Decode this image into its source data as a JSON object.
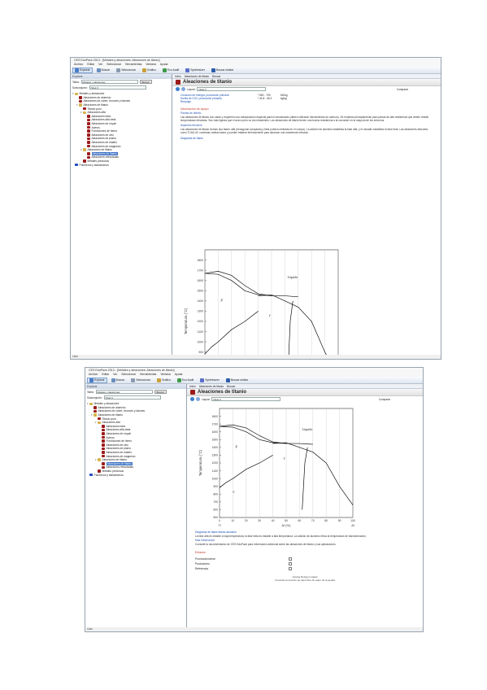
{
  "app": {
    "title": "CES EduPack 2013 - [Metales y aleaciones: Aleaciones de titanio]",
    "menu": [
      "Archivo",
      "Editar",
      "Ver",
      "Seleccionar",
      "Herramientas",
      "Ventana",
      "Ayuda"
    ],
    "toolbar": {
      "browse": "Explorar",
      "search": "Buscar",
      "select": "Seleccionar",
      "chart": "Gráfico",
      "eco": "Eco Audit",
      "synthesizer": "Synthesizer",
      "find": "Buscar similar",
      "home": "Inicio"
    },
    "status": "Listo",
    "colors": {
      "accent": "#3a6fc4",
      "record_icon": "#9b1b1b",
      "section_title": "#c0392b"
    }
  },
  "left": {
    "header": "Explorar",
    "table_label": "Tabla:",
    "table_value": "Metales y aleaciones",
    "subset_label": "Subconjunto:",
    "subset_value": "Nivel 3",
    "search_button": "Buscar",
    "tree": [
      {
        "label": "Metales y aleaciones",
        "depth": 0,
        "type": "folder"
      },
      {
        "label": "Aleaciones de aluminio",
        "depth": 1,
        "type": "record"
      },
      {
        "label": "Aleaciones de cobre, bronces y latones",
        "depth": 1,
        "type": "record"
      },
      {
        "label": "Aleaciones de titanio",
        "depth": 1,
        "type": "folder"
      },
      {
        "label": "Titanio puro",
        "depth": 2,
        "type": "record"
      },
      {
        "label": "Aleaciones alfa",
        "depth": 2,
        "type": "folder"
      },
      {
        "label": "Aleaciones beta",
        "depth": 3,
        "type": "record"
      },
      {
        "label": "Aleaciones alfa-beta",
        "depth": 3,
        "type": "record"
      },
      {
        "label": "Aleaciones de níquel",
        "depth": 3,
        "type": "record"
      },
      {
        "label": "Aceros",
        "depth": 3,
        "type": "record"
      },
      {
        "label": "Fundiciones de hierro",
        "depth": 3,
        "type": "record"
      },
      {
        "label": "Aleaciones de zinc",
        "depth": 3,
        "type": "record"
      },
      {
        "label": "Aleaciones de plomo",
        "depth": 3,
        "type": "record"
      },
      {
        "label": "Aleaciones de estaño",
        "depth": 3,
        "type": "record"
      },
      {
        "label": "Aleaciones de magnesio",
        "depth": 3,
        "type": "record"
      },
      {
        "label": "Aleaciones de titanio",
        "depth": 2,
        "type": "folder"
      },
      {
        "label": "Aleaciones de titanio",
        "depth": 3,
        "type": "selected"
      },
      {
        "label": "Aleaciones refractarias",
        "depth": 3,
        "type": "record"
      },
      {
        "label": "Metales preciosos",
        "depth": 2,
        "type": "record"
      },
      {
        "label": "Polímeros y elastómeros",
        "depth": 0,
        "type": "blue"
      }
    ]
  },
  "right": {
    "tabs": [
      "Inicio",
      "Aleaciones de titanio",
      "Buscar"
    ],
    "record_title": "Aleaciones de titanio",
    "layout_label": "Layout:",
    "layout_value": "Nivel 3",
    "compare_label": "Comparar",
    "properties": [
      {
        "name": "Consumo de energía, producción primaria",
        "value": "* 600 - 700",
        "unit": "MJ/kg"
      },
      {
        "name": "Huella de CO2, producción primaria",
        "value": "* 41.8 - 46.2",
        "unit": "kg/kg"
      },
      {
        "name": "Reciclaje",
        "value": "",
        "unit": ""
      }
    ],
    "support_title": "Información de apoyo",
    "design_title": "Pautas de diseño",
    "design_text": "Las aleaciones de titanio son caras y requieren una manipulación especial para el mecanizado (deben utilizarse herramientas de carburo). Se emplean principalmente para piezas de alta resistencia que deben resistir temperaturas elevadas. Son más ligeras que el acero pero no tan resistentes. Las aleaciones de titanio tienen una buena resistencia a la corrosión en la mayoría de los entornos.",
    "tech_title": "Aspectos técnicos",
    "tech_text": "Las aleaciones de titanio forman dos fases: alfa (hexagonal compacta) y beta (cúbica centrada en el cuerpo). La adición de aluminio estabiliza la fase alfa, y el vanadio estabiliza la fase beta. Las aleaciones alfa-beta, como Ti-6Al-4V, combinan ambas fases y pueden tratarse térmicamente para alcanzar una resistencia elevada.",
    "diagram_link": "Diagrama de fases",
    "diagram_caption": "Diagrama de fases titanio-aluminio",
    "diagram_desc": "La fase alfa es estable a baja temperatura; la fase beta es estable a alta temperatura. La adición de aluminio eleva la temperatura de transformación.",
    "further_title": "Más información",
    "further_text": "Consulte la documentación de CES EduPack para información adicional sobre las aleaciones de titanio y sus aplicaciones.",
    "links_title": "Enlaces",
    "options": [
      "ProcessUniverse",
      "Productores",
      "Referencia"
    ],
    "footer": "Granta Design Limited\nConsulte la sección de derechos de autor de la ayuda"
  },
  "chart_data": {
    "type": "line",
    "title": "",
    "ylabel": "Temperatura (°C)",
    "xlabel": "Al (%)",
    "ylim": [
      500,
      1900
    ],
    "xlim": [
      0,
      100
    ],
    "yticks": [
      500,
      600,
      700,
      800,
      900,
      1000,
      1100,
      1200,
      1300,
      1400,
      1500,
      1600,
      1700,
      1800
    ],
    "xticks": [
      0,
      10,
      20,
      30,
      40,
      50,
      60,
      70,
      80,
      90,
      100
    ],
    "x_end_labels": [
      "Ti",
      "Al"
    ],
    "region_labels": [
      "Líquido",
      "β",
      "α",
      "γ"
    ],
    "series": [
      {
        "x": [
          0,
          10,
          20,
          30,
          40,
          50
        ],
        "y": [
          1670,
          1690,
          1650,
          1550,
          1470,
          1450
        ]
      },
      {
        "x": [
          0,
          10,
          20,
          30,
          40,
          50,
          60,
          70
        ],
        "y": [
          1670,
          1660,
          1600,
          1500,
          1460,
          1450,
          1450,
          1440
        ]
      },
      {
        "x": [
          40,
          50,
          60,
          70,
          80,
          90,
          100
        ],
        "y": [
          1450,
          1460,
          1400,
          1340,
          1200,
          900,
          660
        ]
      },
      {
        "x": [
          0,
          5,
          10,
          20,
          30,
          40
        ],
        "y": [
          882,
          950,
          1000,
          1120,
          1200,
          1300
        ]
      },
      {
        "x": [
          62,
          63,
          64,
          66
        ],
        "y": [
          600,
          900,
          1200,
          1400
        ]
      }
    ]
  }
}
